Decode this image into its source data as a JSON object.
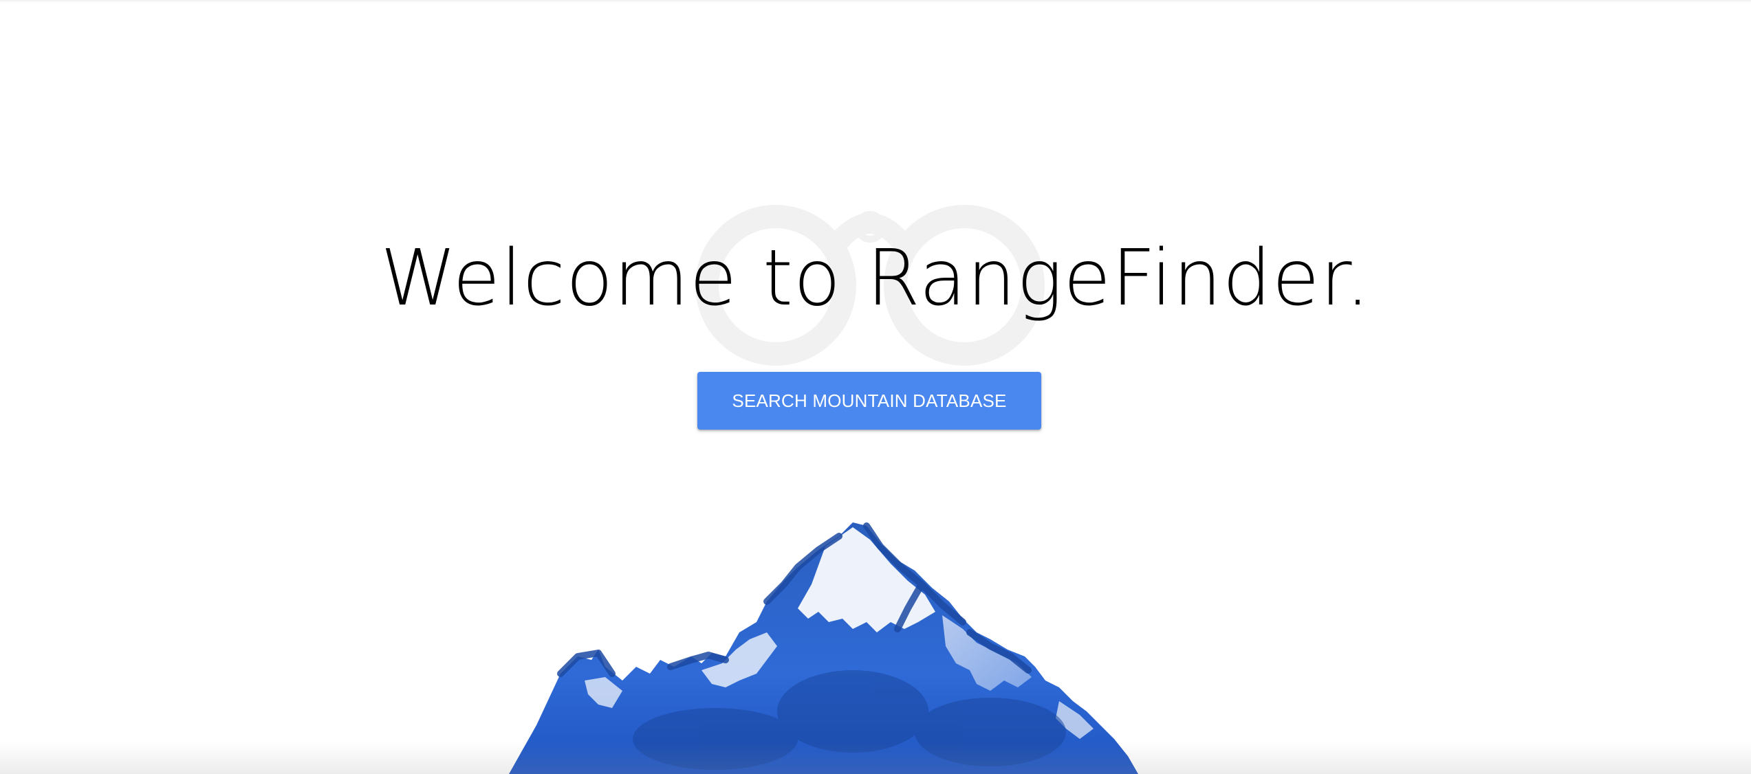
{
  "hero": {
    "title": "Welcome to RangeFinder.",
    "cta_label": "SEARCH MOUNTAIN DATABASE"
  },
  "icons": {
    "logo": "binoculars-icon",
    "illustration": "watercolor-mountain-illustration"
  },
  "colors": {
    "accent": "#4a88ef",
    "title": "#000000",
    "background": "#ffffff",
    "logo_watermark": "#f2f2f2",
    "mountain_dark": "#1f4fa8",
    "mountain_mid": "#3d74d6",
    "mountain_light": "#9fbdef"
  }
}
